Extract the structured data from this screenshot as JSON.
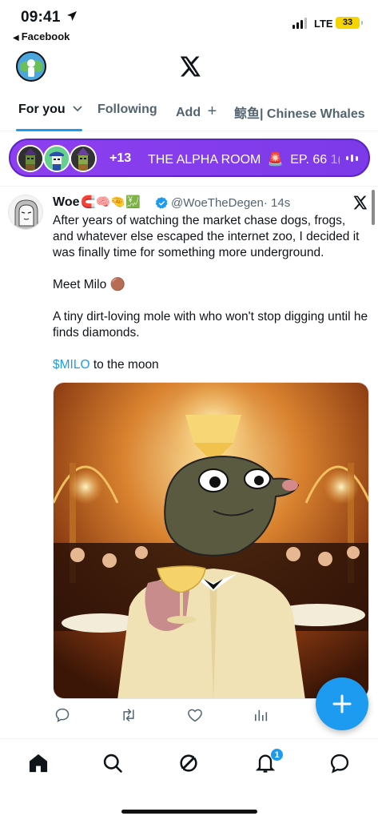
{
  "status_bar": {
    "time": "09:41",
    "back_app": "Facebook",
    "network": "LTE",
    "battery": "33"
  },
  "tabs": [
    {
      "label": "For you",
      "active": true
    },
    {
      "label": "Following"
    },
    {
      "label": "Add"
    },
    {
      "label": "鲸鱼| Chinese Whales"
    }
  ],
  "space": {
    "listener_count": "+13",
    "title": "THE ALPHA ROOM",
    "siren": "🚨",
    "episode": "EP. 66",
    "episode_fade": "1("
  },
  "tweet": {
    "name": "Woe",
    "name_emojis": "🧲🧠🤏💹",
    "handle": "@WoeTheDegen",
    "time": "· 14s",
    "body": [
      "After years of watching the market chase dogs, frogs, and whatever else escaped the internet zoo, I decided it was finally time for something more underground.",
      "Meet Milo 🟤",
      "A tiny dirt-loving mole with who won't stop digging until he finds diamonds."
    ],
    "cashtag": "$MILO",
    "cashtag_rest": " to the moon"
  },
  "notifications_badge": "1",
  "colors": {
    "accent": "#1d9bf0",
    "space_purple": "#8e3ff0",
    "text": "#0f1419",
    "muted": "#536471"
  },
  "icons": {
    "nav": [
      "home-icon",
      "search-icon",
      "grok-icon",
      "bell-icon",
      "messages-icon"
    ],
    "actions": [
      "reply-icon",
      "retweet-icon",
      "like-icon",
      "views-icon"
    ]
  }
}
